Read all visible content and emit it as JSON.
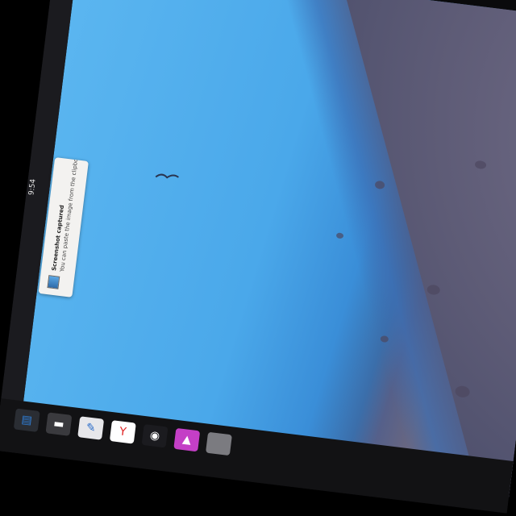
{
  "notification": {
    "title": "Screenshot captured",
    "body": "You can paste the image from the clipboard."
  },
  "top_bar": {
    "clock": "9:54"
  },
  "side_icons": [
    "camera-icon",
    "battery-icon",
    "calendar-icon"
  ],
  "dock": {
    "items": [
      {
        "name": "files-app-icon",
        "glyph": "▤",
        "color": "#2f7fd8",
        "bg": "#2a2d33"
      },
      {
        "name": "terminal-app-icon",
        "glyph": "▬",
        "color": "#ffffff",
        "bg": "#3a3a3e"
      },
      {
        "name": "text-editor-app-icon",
        "glyph": "✎",
        "color": "#2a6cc9",
        "bg": "#e7e7ea"
      },
      {
        "name": "yandex-browser-app-icon",
        "glyph": "Y",
        "color": "#e02828",
        "bg": "#ffffff"
      },
      {
        "name": "obs-studio-app-icon",
        "glyph": "◉",
        "color": "#ffffff",
        "bg": "#1b1b1f"
      },
      {
        "name": "launcher-app-icon",
        "glyph": "▲",
        "color": "#ffffff",
        "bg": "#c43fc6"
      },
      {
        "name": "blank-app-icon",
        "glyph": "",
        "color": "#ffffff",
        "bg": "#7b7b80"
      }
    ]
  },
  "colors": {
    "sky": "#4aa8ea",
    "ground": "#6a6780",
    "panel": "#1b1b1f"
  }
}
